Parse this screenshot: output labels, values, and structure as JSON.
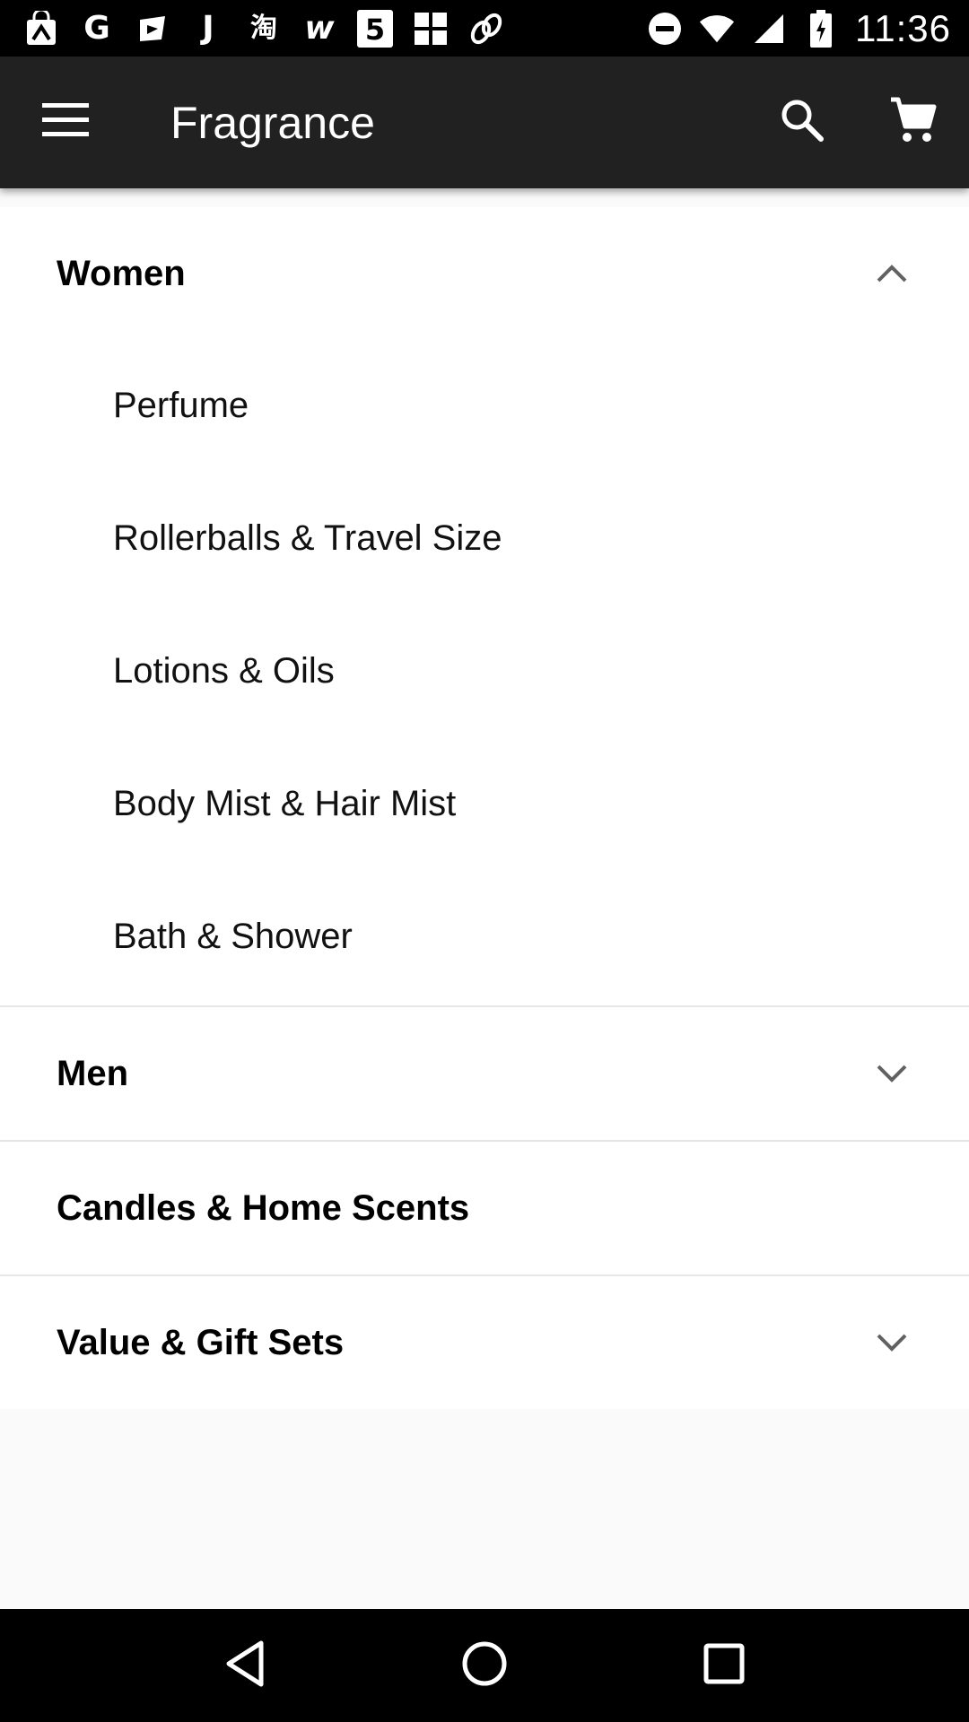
{
  "status_bar": {
    "time": "11:36",
    "notification_icons": [
      "shopping-bag-icon",
      "g-icon",
      "arrow-icon",
      "j-icon",
      "taobao-icon",
      "w-icon",
      "five-icon",
      "grid-icon",
      "link-icon"
    ],
    "system_icons": [
      "do-not-disturb-icon",
      "wifi-icon",
      "signal-icon",
      "battery-icon"
    ]
  },
  "app_bar": {
    "title": "Fragrance",
    "menu_icon": "menu-icon",
    "search_icon": "search-icon",
    "cart_icon": "cart-icon",
    "background": "#212121"
  },
  "categories": [
    {
      "label": "Women",
      "expanded": true,
      "chevron": "chevron-up-icon",
      "items": [
        {
          "label": "Perfume"
        },
        {
          "label": "Rollerballs & Travel Size"
        },
        {
          "label": "Lotions & Oils"
        },
        {
          "label": "Body Mist & Hair Mist"
        },
        {
          "label": "Bath & Shower"
        }
      ]
    },
    {
      "label": "Men",
      "expanded": false,
      "chevron": "chevron-down-icon"
    },
    {
      "label": "Candles & Home Scents",
      "expanded": false
    },
    {
      "label": "Value & Gift Sets",
      "expanded": false,
      "chevron": "chevron-down-icon"
    }
  ],
  "nav_bar": {
    "back_icon": "back-icon",
    "home_icon": "home-icon",
    "recents_icon": "recents-icon"
  }
}
